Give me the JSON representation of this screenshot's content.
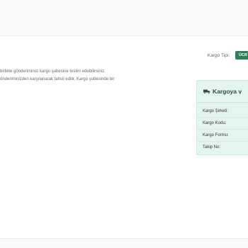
{
  "shipping": {
    "type_label": "Kargo Tipi:",
    "type_value": "ÜCR"
  },
  "notice": {
    "lines": [
      "birlikte gönderiminizi kargo şubesine teslim edebilirsiniz.",
      "önderiminizden karşılanarak tahsil edilir. Kargo şubesinde bir"
    ]
  },
  "cargo_panel": {
    "icon": "truck-icon",
    "title": "Kargoya v",
    "rows": [
      {
        "label": "Kargo Şirketi:",
        "value": ""
      },
      {
        "label": "Kargo Kodu:",
        "value": ""
      },
      {
        "label": "Kargo Formu:",
        "value": ""
      },
      {
        "label": "Takip No:",
        "value": ""
      }
    ]
  },
  "colors": {
    "accent": "#2e7d5b",
    "panel_bg": "#e4f4ef"
  }
}
